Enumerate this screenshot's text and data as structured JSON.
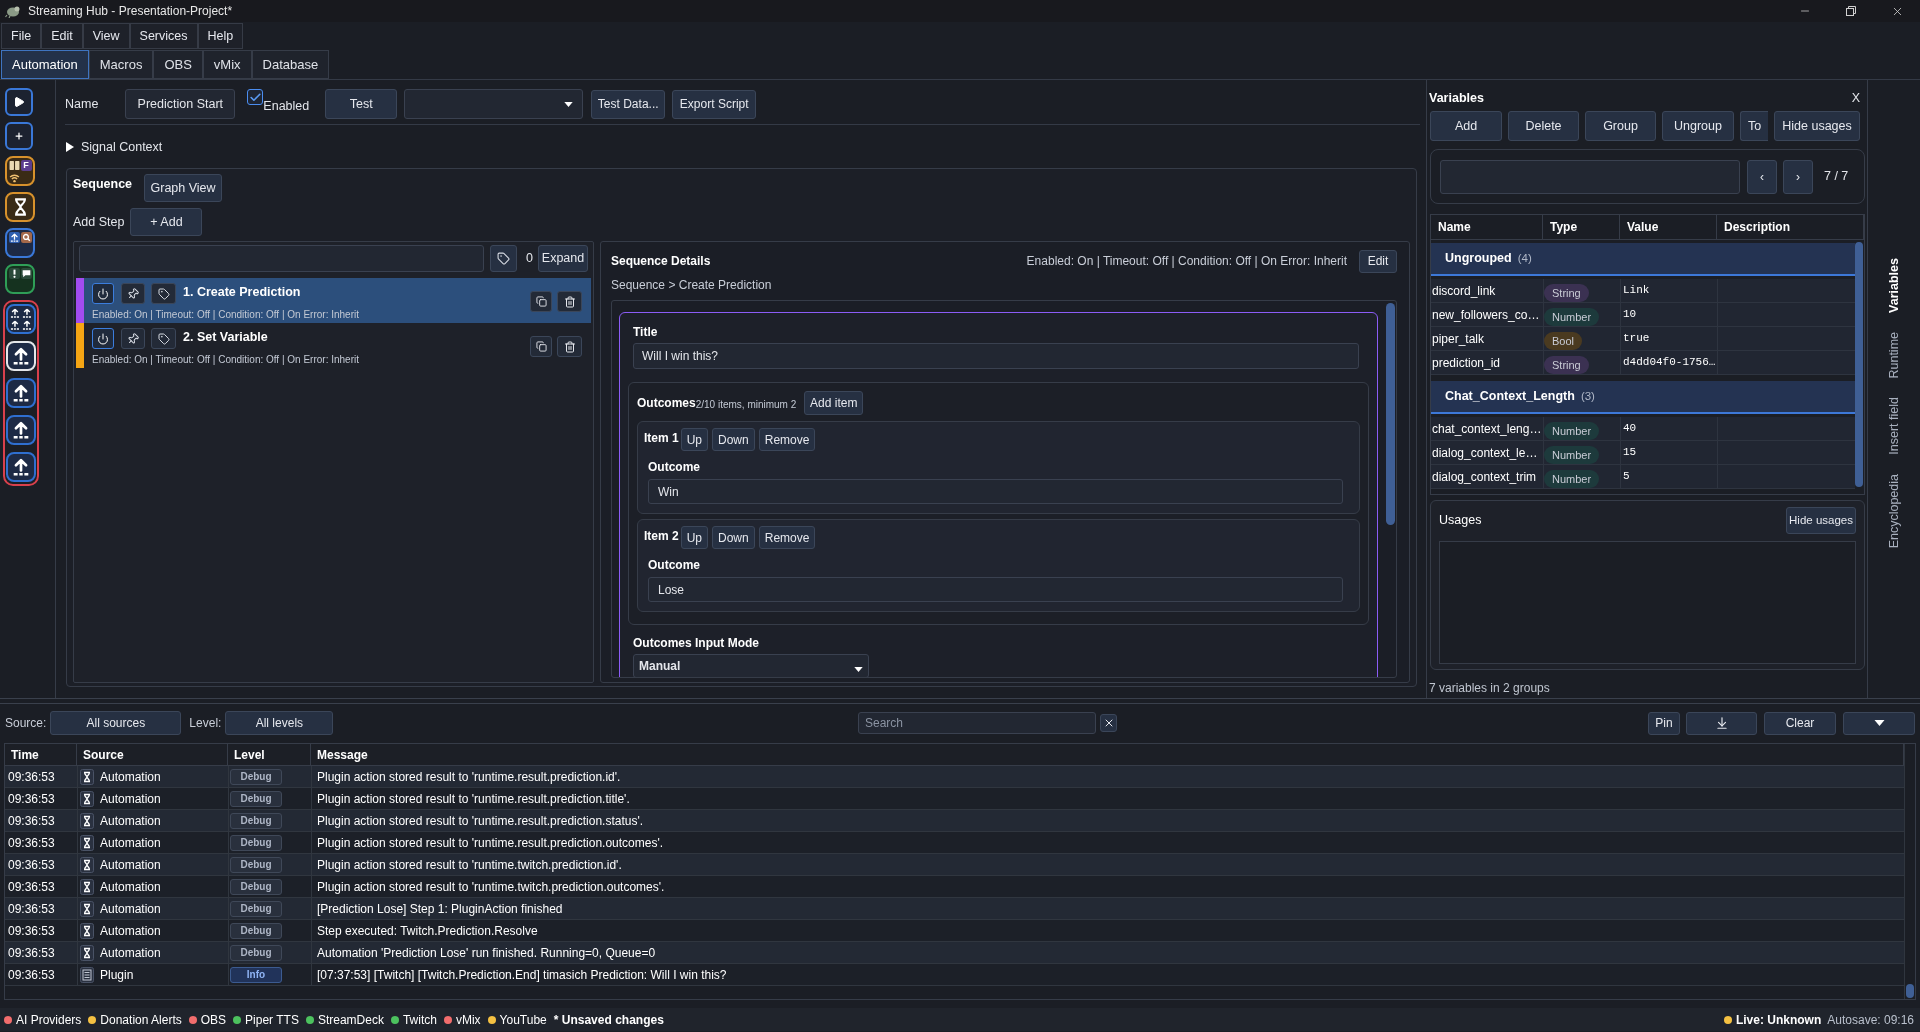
{
  "window": {
    "title": "Streaming Hub - Presentation-Project*"
  },
  "menu": [
    "File",
    "Edit",
    "View",
    "Services",
    "Help"
  ],
  "tabs": [
    {
      "label": "Automation",
      "selected": true
    },
    {
      "label": "Macros",
      "selected": false
    },
    {
      "label": "OBS",
      "selected": false
    },
    {
      "label": "vMix",
      "selected": false
    },
    {
      "label": "Database",
      "selected": false
    }
  ],
  "launcher": {
    "items": [
      {
        "kind": "play",
        "color": "#3a78d8",
        "selected": false
      },
      {
        "kind": "add",
        "color": "#3a78d8",
        "selected": false
      },
      {
        "kind": "apps",
        "color": "#d8922c",
        "selected": false,
        "badge": "F"
      },
      {
        "kind": "hourglass",
        "color": "#d8922c",
        "selected": false
      },
      {
        "kind": "pair",
        "color": "#3a78d8",
        "selected": false
      },
      {
        "kind": "alert",
        "color": "#2f9e57",
        "selected": false
      }
    ],
    "group": {
      "color": "#d9404c",
      "items": [
        {
          "kind": "upload-grid",
          "selected": false
        },
        {
          "kind": "upload",
          "selected": true
        },
        {
          "kind": "upload",
          "selected": false
        },
        {
          "kind": "upload",
          "selected": false
        },
        {
          "kind": "upload",
          "selected": false
        }
      ]
    }
  },
  "editor": {
    "name": {
      "label": "Name",
      "value": "Prediction Start"
    },
    "enabled": {
      "label": "Enabled",
      "checked": true
    },
    "test": "Test",
    "actions": [
      "Test Data...",
      "Export Script"
    ],
    "signal_context": {
      "label": "Signal Context",
      "expanded": false
    }
  },
  "sequence": {
    "label": "Sequence",
    "graph_view": "Graph View",
    "add_step": {
      "label": "Add Step",
      "button": "+ Add"
    },
    "filter": {
      "count": "0",
      "expand": "Expand"
    },
    "steps": [
      {
        "title": "1. Create Prediction",
        "summary": "Enabled: On | Timeout: Off | Condition: Off | On Error: Inherit",
        "color": "#a24cf0",
        "selected": true
      },
      {
        "title": "2. Set Variable",
        "summary": "Enabled: On | Timeout: Off | Condition: Off | On Error: Inherit",
        "color": "#f5a514",
        "selected": false
      }
    ]
  },
  "details": {
    "title": "Sequence Details",
    "summary": "Enabled: On | Timeout: Off | Condition: Off | On Error: Inherit",
    "edit": "Edit",
    "breadcrumb": "Sequence > Create Prediction",
    "title_field": {
      "label": "Title",
      "value": "Will I win this?"
    },
    "outcomes": {
      "label": "Outcomes",
      "hint": "2/10 items, minimum 2",
      "add": "Add item",
      "items": [
        {
          "label": "Item 1",
          "buttons": [
            "Up",
            "Down",
            "Remove"
          ],
          "field_label": "Outcome",
          "value": "Win"
        },
        {
          "label": "Item 2",
          "buttons": [
            "Up",
            "Down",
            "Remove"
          ],
          "field_label": "Outcome",
          "value": "Lose"
        }
      ]
    },
    "input_mode": {
      "label": "Outcomes Input Mode",
      "value": "Manual"
    }
  },
  "variables": {
    "title": "Variables",
    "close": "X",
    "buttons": [
      "Add",
      "Delete",
      "Group",
      "Ungroup",
      "To",
      "Hide usages"
    ],
    "pager": {
      "prev": "‹",
      "next": "›",
      "count": "7 / 7"
    },
    "columns": [
      "Name",
      "Type",
      "Value",
      "Description"
    ],
    "groups": [
      {
        "name": "Ungrouped",
        "count": "(4)",
        "rows": [
          {
            "name": "discord_link",
            "type": "String",
            "color": "#3b3152",
            "value": "Link"
          },
          {
            "name": "new_followers_co…",
            "type": "Number",
            "color": "#1d3a3c",
            "value": "10"
          },
          {
            "name": "piper_talk",
            "type": "Bool",
            "color": "#4a3a20",
            "value": "true"
          },
          {
            "name": "prediction_id",
            "type": "String",
            "color": "#3b3152",
            "value": "d4dd04f0-1756…"
          }
        ]
      },
      {
        "name": "Chat_Context_Length",
        "count": "(3)",
        "rows": [
          {
            "name": "chat_context_leng…",
            "type": "Number",
            "color": "#1d3a3c",
            "value": "40"
          },
          {
            "name": "dialog_context_le…",
            "type": "Number",
            "color": "#1d3a3c",
            "value": "15"
          },
          {
            "name": "dialog_context_trim",
            "type": "Number",
            "color": "#1d3a3c",
            "value": "5"
          }
        ]
      }
    ],
    "usages": {
      "title": "Usages",
      "button": "Hide usages"
    },
    "footer": "7 variables in 2 groups"
  },
  "side_tabs": [
    {
      "label": "Variables",
      "selected": true
    },
    {
      "label": "Runtime",
      "selected": false
    },
    {
      "label": "Insert field",
      "selected": false
    },
    {
      "label": "Encyclopedia",
      "selected": false
    }
  ],
  "log": {
    "source": {
      "label": "Source:",
      "value": "All sources"
    },
    "level": {
      "label": "Level:",
      "value": "All levels"
    },
    "search": {
      "placeholder": "Search"
    },
    "pin": "Pin",
    "clear": "Clear",
    "columns": [
      "Time",
      "Source",
      "Level",
      "Message"
    ],
    "rows": [
      {
        "time": "09:36:53",
        "kind": "automation",
        "source": "Automation",
        "level": {
          "text": "Debug",
          "kind": "debug"
        },
        "message": "Plugin action stored result to 'runtime.result.prediction.id'."
      },
      {
        "time": "09:36:53",
        "kind": "automation",
        "source": "Automation",
        "level": {
          "text": "Debug",
          "kind": "debug"
        },
        "message": "Plugin action stored result to 'runtime.result.prediction.title'."
      },
      {
        "time": "09:36:53",
        "kind": "automation",
        "source": "Automation",
        "level": {
          "text": "Debug",
          "kind": "debug"
        },
        "message": "Plugin action stored result to 'runtime.result.prediction.status'."
      },
      {
        "time": "09:36:53",
        "kind": "automation",
        "source": "Automation",
        "level": {
          "text": "Debug",
          "kind": "debug"
        },
        "message": "Plugin action stored result to 'runtime.result.prediction.outcomes'."
      },
      {
        "time": "09:36:53",
        "kind": "automation",
        "source": "Automation",
        "level": {
          "text": "Debug",
          "kind": "debug"
        },
        "message": "Plugin action stored result to 'runtime.twitch.prediction.id'."
      },
      {
        "time": "09:36:53",
        "kind": "automation",
        "source": "Automation",
        "level": {
          "text": "Debug",
          "kind": "debug"
        },
        "message": "Plugin action stored result to 'runtime.twitch.prediction.outcomes'."
      },
      {
        "time": "09:36:53",
        "kind": "automation",
        "source": "Automation",
        "level": {
          "text": "Debug",
          "kind": "debug"
        },
        "message": "[Prediction Lose] Step 1: PluginAction finished"
      },
      {
        "time": "09:36:53",
        "kind": "automation",
        "source": "Automation",
        "level": {
          "text": "Debug",
          "kind": "debug"
        },
        "message": "Step executed: Twitch.Prediction.Resolve"
      },
      {
        "time": "09:36:53",
        "kind": "automation",
        "source": "Automation",
        "level": {
          "text": "Debug",
          "kind": "debug"
        },
        "message": "Automation 'Prediction Lose' run finished. Running=0, Queue=0"
      },
      {
        "time": "09:36:53",
        "kind": "plugin",
        "source": "Plugin",
        "level": {
          "text": "Info",
          "kind": "info"
        },
        "message": "[07:37:53] [Twitch] [Twitch.Prediction.End] timasich Prediction: Will I win this?"
      }
    ]
  },
  "status_bar": {
    "services": [
      {
        "name": "AI Providers",
        "color": "#f26d6d"
      },
      {
        "name": "Donation Alerts",
        "color": "#f5c142"
      },
      {
        "name": "OBS",
        "color": "#f26d6d"
      },
      {
        "name": "Piper TTS",
        "color": "#4cc25e"
      },
      {
        "name": "StreamDeck",
        "color": "#4cc25e"
      },
      {
        "name": "Twitch",
        "color": "#4cc25e"
      },
      {
        "name": "vMix",
        "color": "#f26d6d"
      },
      {
        "name": "YouTube",
        "color": "#f5c142"
      }
    ],
    "unsaved": "* Unsaved changes",
    "live": {
      "label": "Live: Unknown",
      "color": "#f5c142"
    },
    "autosave": "Autosave: 09:16"
  }
}
